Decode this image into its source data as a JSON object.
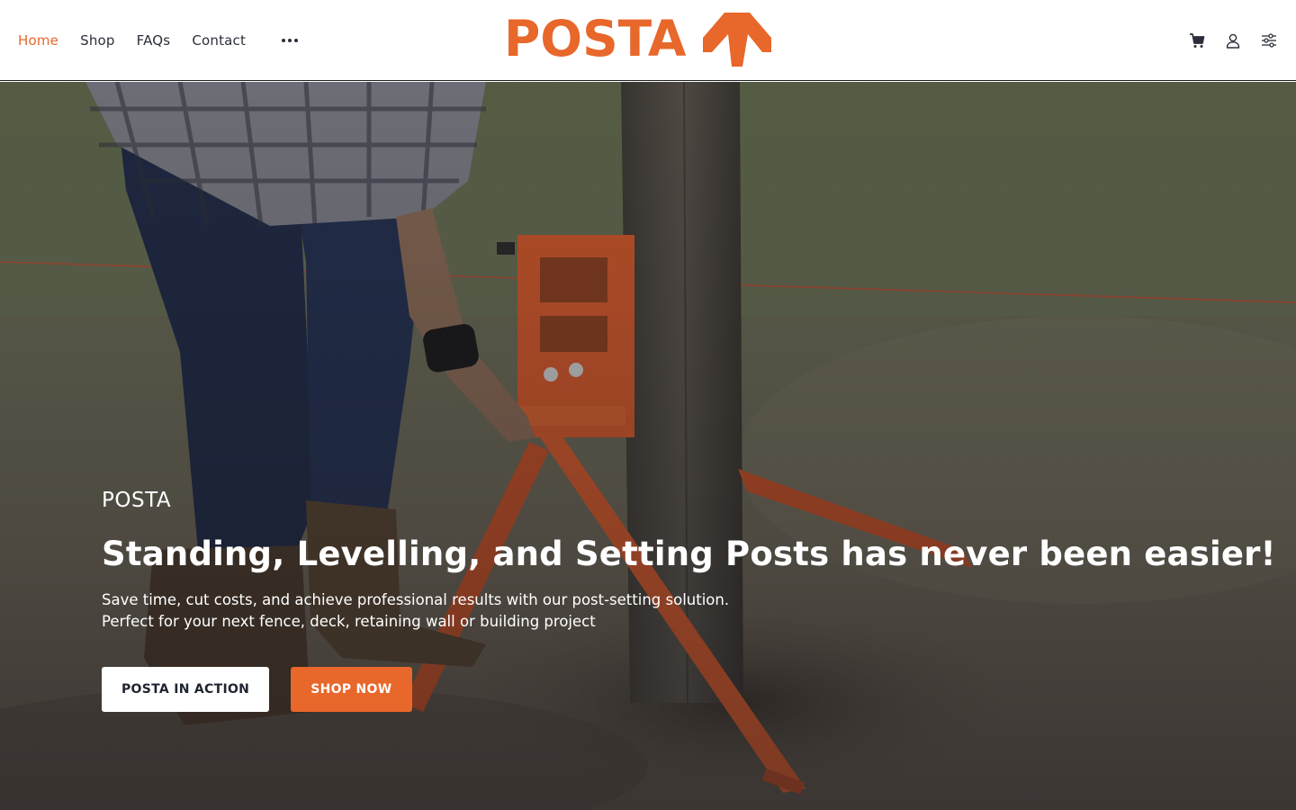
{
  "header": {
    "nav": [
      {
        "label": "Home",
        "active": true
      },
      {
        "label": "Shop",
        "active": false
      },
      {
        "label": "FAQs",
        "active": false
      },
      {
        "label": "Contact",
        "active": false
      }
    ],
    "logo_text": "POSTA",
    "icons": [
      "more-icon",
      "cart-icon",
      "account-icon",
      "settings-sliders-icon"
    ]
  },
  "hero": {
    "eyebrow": "POSTA",
    "headline": "Standing, Levelling, and Setting Posts has never been easier!",
    "subtext_line1": "Save time, cut costs, and achieve professional results with our post-setting solution.",
    "subtext_line2": "Perfect for your next fence, deck, retaining wall or building project",
    "buttons": {
      "primary": "POSTA IN ACTION",
      "secondary": "SHOP NOW"
    }
  },
  "colors": {
    "brand": "#e8672a",
    "text_dark": "#2b2f3a",
    "white": "#ffffff"
  }
}
